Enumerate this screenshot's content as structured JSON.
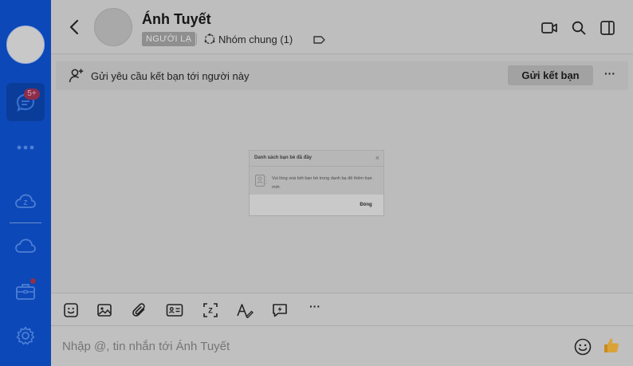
{
  "sidebar": {
    "unread_badge": "5+",
    "icons": [
      "avatar",
      "message-icon",
      "more-dots-icon",
      "zcloud-icon",
      "cloud-icon",
      "toolbox-icon",
      "gear-icon"
    ]
  },
  "header": {
    "name": "Ánh Tuyết",
    "stranger_tag": "NGƯỜI LẠ",
    "common_groups": "Nhóm chung (1)"
  },
  "friend_bar": {
    "text": "Gửi yêu cầu kết bạn tới người này",
    "send_button": "Gửi kết bạn",
    "more": "···"
  },
  "dialog": {
    "title": "Danh sách bạn bè đã đầy",
    "close": "×",
    "message": "Vui lòng xoá bớt bạn bè trong danh bạ để thêm bạn mới.",
    "close_button": "Đóng"
  },
  "toolbar": {
    "icons": [
      "sticker-icon",
      "image-icon",
      "attachment-icon",
      "contact-card-icon",
      "screenshot-icon",
      "text-format-icon",
      "quick-message-icon",
      "more-icon"
    ],
    "more": "···"
  },
  "composer": {
    "placeholder": "Nhập @, tin nhắn tới Ánh Tuyết",
    "like_emoji": "👍"
  },
  "colors": {
    "sidebar": "#0c48b7",
    "overlay_gray": "#bcbcbc"
  }
}
